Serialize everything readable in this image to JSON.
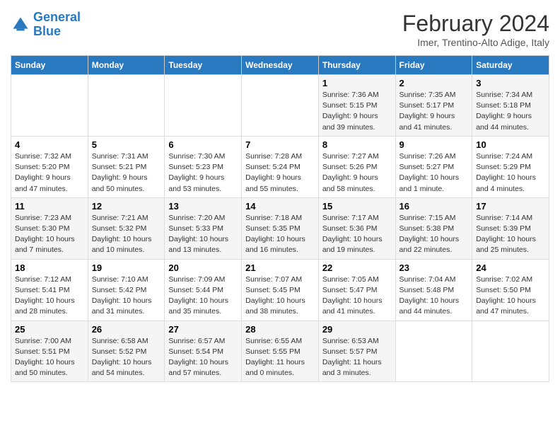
{
  "header": {
    "logo_line1": "General",
    "logo_line2": "Blue",
    "main_title": "February 2024",
    "sub_title": "Imer, Trentino-Alto Adige, Italy"
  },
  "days_of_week": [
    "Sunday",
    "Monday",
    "Tuesday",
    "Wednesday",
    "Thursday",
    "Friday",
    "Saturday"
  ],
  "weeks": [
    [
      {
        "day": "",
        "info": ""
      },
      {
        "day": "",
        "info": ""
      },
      {
        "day": "",
        "info": ""
      },
      {
        "day": "",
        "info": ""
      },
      {
        "day": "1",
        "info": "Sunrise: 7:36 AM\nSunset: 5:15 PM\nDaylight: 9 hours\nand 39 minutes."
      },
      {
        "day": "2",
        "info": "Sunrise: 7:35 AM\nSunset: 5:17 PM\nDaylight: 9 hours\nand 41 minutes."
      },
      {
        "day": "3",
        "info": "Sunrise: 7:34 AM\nSunset: 5:18 PM\nDaylight: 9 hours\nand 44 minutes."
      }
    ],
    [
      {
        "day": "4",
        "info": "Sunrise: 7:32 AM\nSunset: 5:20 PM\nDaylight: 9 hours\nand 47 minutes."
      },
      {
        "day": "5",
        "info": "Sunrise: 7:31 AM\nSunset: 5:21 PM\nDaylight: 9 hours\nand 50 minutes."
      },
      {
        "day": "6",
        "info": "Sunrise: 7:30 AM\nSunset: 5:23 PM\nDaylight: 9 hours\nand 53 minutes."
      },
      {
        "day": "7",
        "info": "Sunrise: 7:28 AM\nSunset: 5:24 PM\nDaylight: 9 hours\nand 55 minutes."
      },
      {
        "day": "8",
        "info": "Sunrise: 7:27 AM\nSunset: 5:26 PM\nDaylight: 9 hours\nand 58 minutes."
      },
      {
        "day": "9",
        "info": "Sunrise: 7:26 AM\nSunset: 5:27 PM\nDaylight: 10 hours\nand 1 minute."
      },
      {
        "day": "10",
        "info": "Sunrise: 7:24 AM\nSunset: 5:29 PM\nDaylight: 10 hours\nand 4 minutes."
      }
    ],
    [
      {
        "day": "11",
        "info": "Sunrise: 7:23 AM\nSunset: 5:30 PM\nDaylight: 10 hours\nand 7 minutes."
      },
      {
        "day": "12",
        "info": "Sunrise: 7:21 AM\nSunset: 5:32 PM\nDaylight: 10 hours\nand 10 minutes."
      },
      {
        "day": "13",
        "info": "Sunrise: 7:20 AM\nSunset: 5:33 PM\nDaylight: 10 hours\nand 13 minutes."
      },
      {
        "day": "14",
        "info": "Sunrise: 7:18 AM\nSunset: 5:35 PM\nDaylight: 10 hours\nand 16 minutes."
      },
      {
        "day": "15",
        "info": "Sunrise: 7:17 AM\nSunset: 5:36 PM\nDaylight: 10 hours\nand 19 minutes."
      },
      {
        "day": "16",
        "info": "Sunrise: 7:15 AM\nSunset: 5:38 PM\nDaylight: 10 hours\nand 22 minutes."
      },
      {
        "day": "17",
        "info": "Sunrise: 7:14 AM\nSunset: 5:39 PM\nDaylight: 10 hours\nand 25 minutes."
      }
    ],
    [
      {
        "day": "18",
        "info": "Sunrise: 7:12 AM\nSunset: 5:41 PM\nDaylight: 10 hours\nand 28 minutes."
      },
      {
        "day": "19",
        "info": "Sunrise: 7:10 AM\nSunset: 5:42 PM\nDaylight: 10 hours\nand 31 minutes."
      },
      {
        "day": "20",
        "info": "Sunrise: 7:09 AM\nSunset: 5:44 PM\nDaylight: 10 hours\nand 35 minutes."
      },
      {
        "day": "21",
        "info": "Sunrise: 7:07 AM\nSunset: 5:45 PM\nDaylight: 10 hours\nand 38 minutes."
      },
      {
        "day": "22",
        "info": "Sunrise: 7:05 AM\nSunset: 5:47 PM\nDaylight: 10 hours\nand 41 minutes."
      },
      {
        "day": "23",
        "info": "Sunrise: 7:04 AM\nSunset: 5:48 PM\nDaylight: 10 hours\nand 44 minutes."
      },
      {
        "day": "24",
        "info": "Sunrise: 7:02 AM\nSunset: 5:50 PM\nDaylight: 10 hours\nand 47 minutes."
      }
    ],
    [
      {
        "day": "25",
        "info": "Sunrise: 7:00 AM\nSunset: 5:51 PM\nDaylight: 10 hours\nand 50 minutes."
      },
      {
        "day": "26",
        "info": "Sunrise: 6:58 AM\nSunset: 5:52 PM\nDaylight: 10 hours\nand 54 minutes."
      },
      {
        "day": "27",
        "info": "Sunrise: 6:57 AM\nSunset: 5:54 PM\nDaylight: 10 hours\nand 57 minutes."
      },
      {
        "day": "28",
        "info": "Sunrise: 6:55 AM\nSunset: 5:55 PM\nDaylight: 11 hours\nand 0 minutes."
      },
      {
        "day": "29",
        "info": "Sunrise: 6:53 AM\nSunset: 5:57 PM\nDaylight: 11 hours\nand 3 minutes."
      },
      {
        "day": "",
        "info": ""
      },
      {
        "day": "",
        "info": ""
      }
    ]
  ]
}
